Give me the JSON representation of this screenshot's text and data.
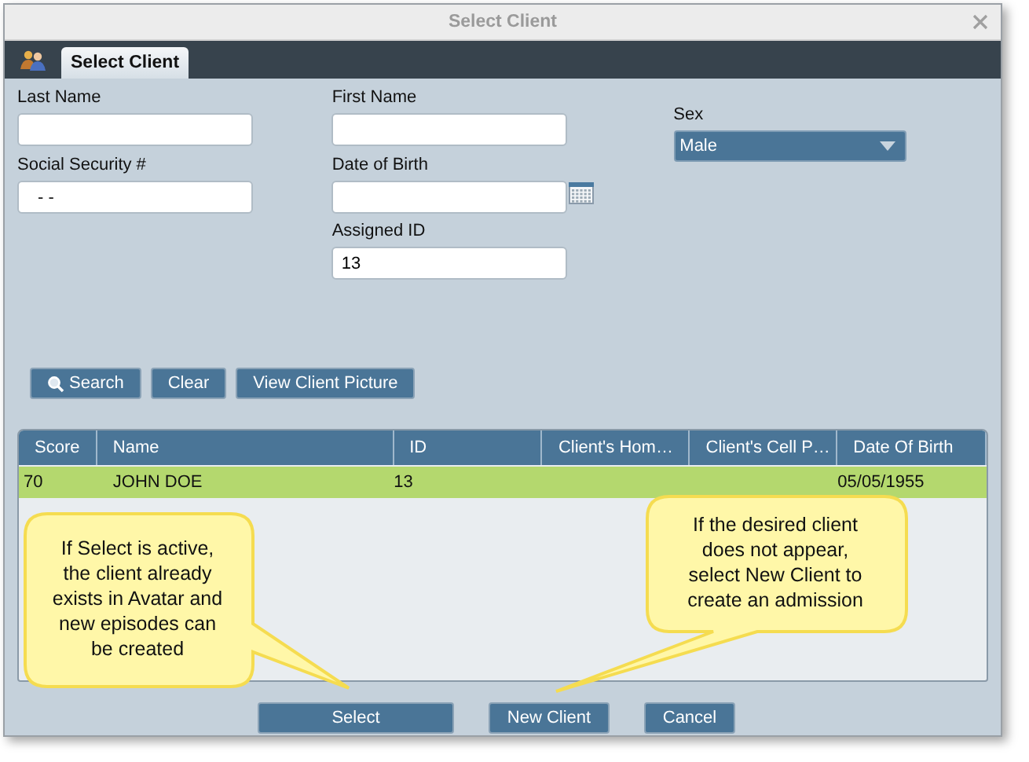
{
  "window": {
    "title": "Select Client"
  },
  "tabs": [
    {
      "label": "Select Client",
      "selected": true
    }
  ],
  "form": {
    "fields": [
      {
        "label": "Last Name"
      },
      {
        "label": "First Name"
      },
      {
        "label": "Social Security #",
        "value": "- -"
      },
      {
        "label": "Date of Birth",
        "kind": "date"
      },
      {
        "label": "Assigned ID",
        "value": "13"
      }
    ],
    "sex": {
      "label": "Sex",
      "value": "Male"
    }
  },
  "actions": [
    {
      "label": "Search",
      "kind": "search"
    },
    {
      "label": "Clear",
      "kind": "plain"
    },
    {
      "label": "View Client Picture",
      "kind": "plain"
    }
  ],
  "table": {
    "columns": [
      "Score",
      "Name",
      "ID",
      "Client's Hom…",
      "Client's Cell P…",
      "Date Of Birth"
    ],
    "rows": [
      {
        "cells": [
          "70",
          "JOHN DOE",
          "13",
          "",
          "",
          "05/05/1955"
        ],
        "selected": true
      }
    ]
  },
  "callouts": [
    {
      "text": "If Select is active, the client already exists in Avatar and new episodes can be created"
    },
    {
      "text": "If the desired client does not appear, select New Client to create an admission"
    }
  ],
  "buttons": [
    "Select",
    "New Client",
    "Cancel"
  ]
}
